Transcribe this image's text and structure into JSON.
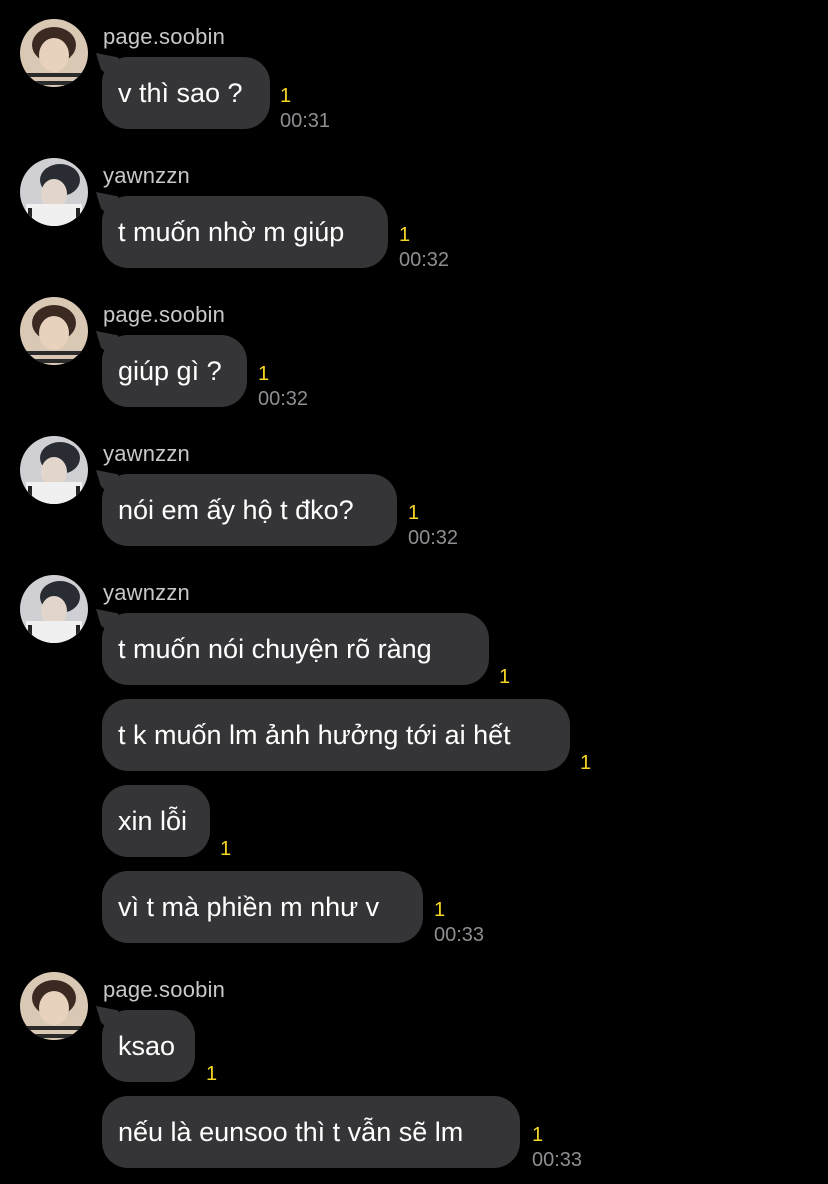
{
  "colors": {
    "background": "#000000",
    "bubble": "#353538",
    "unread": "#f5d623",
    "sender": "#c8c8c8",
    "time": "#8e8e93"
  },
  "messages": [
    {
      "sender": "page.soobin",
      "text": "v thì sao ?",
      "unread": "1",
      "time": "00:31"
    },
    {
      "sender": "yawnzzn",
      "text": "t muốn nhờ m giúp",
      "unread": "1",
      "time": "00:32"
    },
    {
      "sender": "page.soobin",
      "text": "giúp gì ?",
      "unread": "1",
      "time": "00:32"
    },
    {
      "sender": "yawnzzn",
      "text": "nói em ấy hộ t đko?",
      "unread": "1",
      "time": "00:32"
    },
    {
      "sender": "yawnzzn",
      "text": "t muốn nói chuyện rõ ràng",
      "unread": "1"
    },
    {
      "text": "t k muốn lm ảnh hưởng tới ai hết",
      "unread": "1"
    },
    {
      "text": "xin lỗi",
      "unread": "1"
    },
    {
      "text": "vì t mà phiền m như v",
      "unread": "1",
      "time": "00:33"
    },
    {
      "sender": "page.soobin",
      "text": "ksao",
      "unread": "1"
    },
    {
      "text": "nếu là eunsoo thì t vẫn sẽ lm",
      "unread": "1",
      "time": "00:33"
    }
  ]
}
